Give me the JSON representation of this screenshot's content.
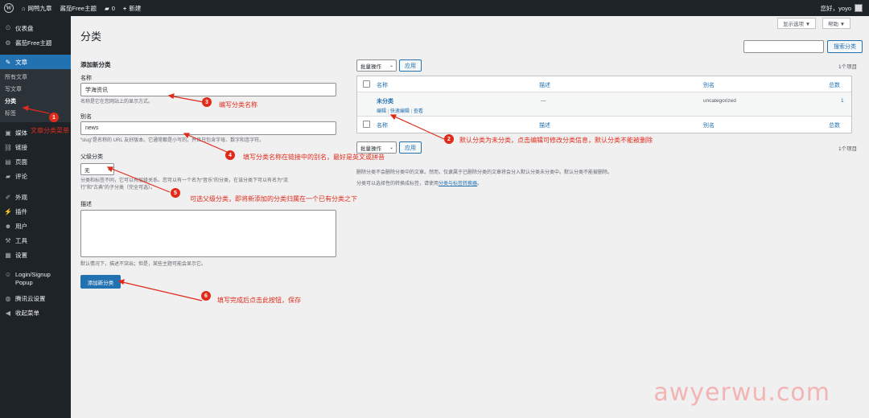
{
  "adminbar": {
    "site_name": "网鸭九章",
    "theme_label": "酱茄Free主题",
    "comments_count": "0",
    "new_label": "新建",
    "greeting": "您好，yoyo"
  },
  "sidebar": {
    "items": [
      {
        "label": "仪表盘",
        "icon": "dashboard-icon",
        "glyph": "⏲"
      },
      {
        "label": "酱茄Free主题",
        "icon": "gear-icon",
        "glyph": "⚙"
      },
      {
        "label": "文章",
        "icon": "pin-icon",
        "glyph": "✎"
      },
      {
        "label": "媒体",
        "icon": "media-icon",
        "glyph": "▣"
      },
      {
        "label": "链接",
        "icon": "link-icon",
        "glyph": "⛓"
      },
      {
        "label": "页面",
        "icon": "page-icon",
        "glyph": "▤"
      },
      {
        "label": "评论",
        "icon": "comment-icon",
        "glyph": "▰"
      },
      {
        "label": "外观",
        "icon": "brush-icon",
        "glyph": "✐"
      },
      {
        "label": "插件",
        "icon": "plug-icon",
        "glyph": "⚡"
      },
      {
        "label": "用户",
        "icon": "user-icon",
        "glyph": "☻"
      },
      {
        "label": "工具",
        "icon": "wrench-icon",
        "glyph": "⚒"
      },
      {
        "label": "设置",
        "icon": "settings-icon",
        "glyph": "▦"
      },
      {
        "label": "Login/Signup Popup",
        "icon": "popup-icon",
        "glyph": "☺"
      },
      {
        "label": "腾讯云设置",
        "icon": "globe-icon",
        "glyph": "◍"
      },
      {
        "label": "收起菜单",
        "icon": "collapse-icon",
        "glyph": "◀"
      }
    ],
    "submenu": [
      "所有文章",
      "写文章",
      "分类",
      "标签"
    ]
  },
  "header": {
    "title": "分类",
    "screen_options": "显示选项 ▼",
    "help": "帮助 ▼"
  },
  "search": {
    "button": "搜索分类"
  },
  "form": {
    "heading": "添加新分类",
    "name_label": "名称",
    "name_value": "学海资讯",
    "name_desc": "名称是它在您网站上的显示方式。",
    "slug_label": "别名",
    "slug_value": "news",
    "slug_desc": "“slug”是名称的 URL 友好版本。它通常都是小写的，并且只包含字母、数字和连字符。",
    "parent_label": "父级分类",
    "parent_value": "无",
    "parent_desc_1": "分类和标签不同，它可以有层级关系。您可以有一个名为“音乐”的分类，在该分类下可以有名为“流",
    "parent_desc_2": "行”和“古典”的子分类（完全可选）。",
    "desc_label": "描述",
    "desc_help": "默认情况下，描述不突出；但是，某些主题可能会显示它。",
    "submit": "添加新分类"
  },
  "table": {
    "bulk_action": "批量操作",
    "apply": "应用",
    "count": "1个项目",
    "columns": [
      "名称",
      "描述",
      "别名",
      "总数"
    ],
    "rows": [
      {
        "name": "未分类",
        "description": "—",
        "slug": "uncategorized",
        "count": "1",
        "actions": [
          "编辑",
          "快速编辑",
          "查看"
        ]
      }
    ]
  },
  "notes": {
    "line1": "删除分类不会删除分类中的文章。然而，仅隶属于已删除分类的文章将会分入默认分类未分类中。默认分类不能被删除。",
    "line2_prefix": "分类可以选择性的转换成标签，请使用",
    "line2_link": "分类与标签转换器",
    "line2_suffix": "。"
  },
  "annotations": [
    {
      "num": "1",
      "text": "文章分类菜单"
    },
    {
      "num": "2",
      "text": "默认分类为未分类，点击编辑可修改分类信息，默认分类不能被删除"
    },
    {
      "num": "3",
      "text": "编写分类名称"
    },
    {
      "num": "4",
      "text": "填写分类名称在链接中的别名，最好是英文或拼音"
    },
    {
      "num": "5",
      "text": "可选父级分类，即将新添加的分类归属在一个已有分类之下"
    },
    {
      "num": "6",
      "text": "填写完成后点击此按钮，保存"
    }
  ],
  "colors": {
    "accent": "#2271b1",
    "annotation": "#e02a1a",
    "sidebar": "#1d2327"
  },
  "watermark": "awyerwu.com"
}
